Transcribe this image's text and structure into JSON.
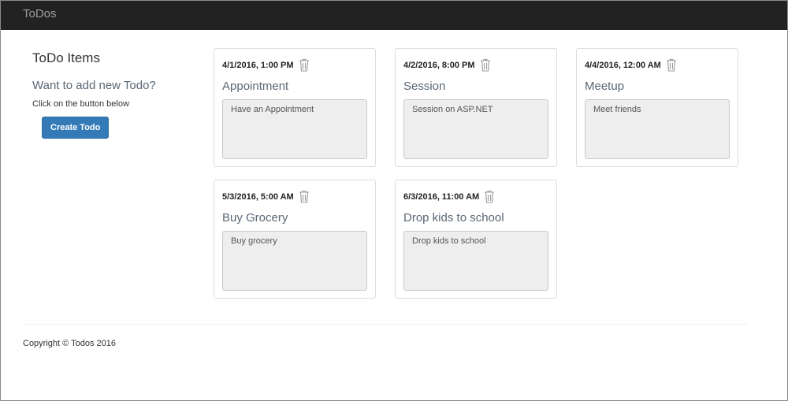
{
  "navbar": {
    "brand": "ToDos"
  },
  "sidebar": {
    "heading": "ToDo Items",
    "subheading": "Want to add new Todo?",
    "hint": "Click on the button below",
    "create_button": "Create Todo"
  },
  "todos": [
    {
      "date": "4/1/2016, 1:00 PM",
      "title": "Appointment",
      "description": "Have an Appointment",
      "icon": "trash-icon"
    },
    {
      "date": "4/2/2016, 8:00 PM",
      "title": "Session",
      "description": "Session on ASP.NET",
      "icon": "trash-icon"
    },
    {
      "date": "4/4/2016, 12:00 AM",
      "title": "Meetup",
      "description": "Meet friends",
      "icon": "trash-icon"
    },
    {
      "date": "5/3/2016, 5:00 AM",
      "title": "Buy Grocery",
      "description": "Buy grocery",
      "icon": "trash-icon"
    },
    {
      "date": "6/3/2016, 11:00 AM",
      "title": "Drop kids to school",
      "description": "Drop kids to school",
      "icon": "trash-icon"
    }
  ],
  "footer": {
    "copyright": "Copyright © Todos 2016"
  },
  "colors": {
    "navbar": "#222222",
    "primary_button": "#337ab7",
    "card_border": "#dddddd",
    "textarea_bg": "#eeeeee"
  }
}
